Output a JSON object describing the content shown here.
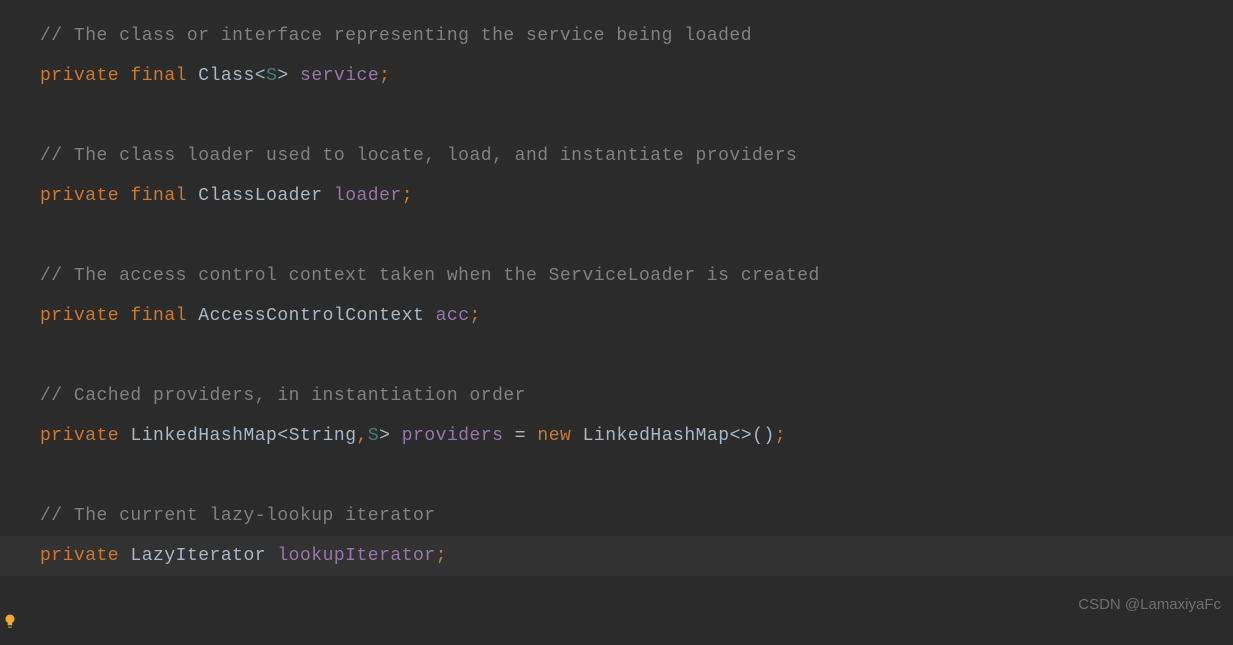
{
  "code": {
    "lines": [
      {
        "tokens": [
          {
            "t": "// The class or interface representing the service being loaded",
            "c": "tok-comment"
          }
        ]
      },
      {
        "tokens": [
          {
            "t": "private",
            "c": "tok-keyword"
          },
          {
            "t": " ",
            "c": ""
          },
          {
            "t": "final",
            "c": "tok-keyword"
          },
          {
            "t": " ",
            "c": ""
          },
          {
            "t": "Class",
            "c": "tok-type"
          },
          {
            "t": "<",
            "c": "tok-punct"
          },
          {
            "t": "S",
            "c": "tok-generic"
          },
          {
            "t": ">",
            "c": "tok-punct"
          },
          {
            "t": " ",
            "c": ""
          },
          {
            "t": "service",
            "c": "tok-field"
          },
          {
            "t": ";",
            "c": "tok-semi"
          }
        ]
      },
      {
        "tokens": [
          {
            "t": "",
            "c": ""
          }
        ]
      },
      {
        "tokens": [
          {
            "t": "// The class loader used to locate, load, and instantiate providers",
            "c": "tok-comment"
          }
        ]
      },
      {
        "tokens": [
          {
            "t": "private",
            "c": "tok-keyword"
          },
          {
            "t": " ",
            "c": ""
          },
          {
            "t": "final",
            "c": "tok-keyword"
          },
          {
            "t": " ",
            "c": ""
          },
          {
            "t": "ClassLoader",
            "c": "tok-type"
          },
          {
            "t": " ",
            "c": ""
          },
          {
            "t": "loader",
            "c": "tok-field"
          },
          {
            "t": ";",
            "c": "tok-semi"
          }
        ]
      },
      {
        "tokens": [
          {
            "t": "",
            "c": ""
          }
        ]
      },
      {
        "tokens": [
          {
            "t": "// The access control context taken when the ServiceLoader is created",
            "c": "tok-comment"
          }
        ]
      },
      {
        "tokens": [
          {
            "t": "private",
            "c": "tok-keyword"
          },
          {
            "t": " ",
            "c": ""
          },
          {
            "t": "final",
            "c": "tok-keyword"
          },
          {
            "t": " ",
            "c": ""
          },
          {
            "t": "AccessControlContext",
            "c": "tok-type"
          },
          {
            "t": " ",
            "c": ""
          },
          {
            "t": "acc",
            "c": "tok-field"
          },
          {
            "t": ";",
            "c": "tok-semi"
          }
        ]
      },
      {
        "tokens": [
          {
            "t": "",
            "c": ""
          }
        ]
      },
      {
        "tokens": [
          {
            "t": "// Cached providers, in instantiation order",
            "c": "tok-comment"
          }
        ]
      },
      {
        "tokens": [
          {
            "t": "private",
            "c": "tok-keyword"
          },
          {
            "t": " ",
            "c": ""
          },
          {
            "t": "LinkedHashMap",
            "c": "tok-type"
          },
          {
            "t": "<",
            "c": "tok-punct"
          },
          {
            "t": "String",
            "c": "tok-type"
          },
          {
            "t": ",",
            "c": "tok-semi"
          },
          {
            "t": "S",
            "c": "tok-generic"
          },
          {
            "t": ">",
            "c": "tok-punct"
          },
          {
            "t": " ",
            "c": ""
          },
          {
            "t": "providers",
            "c": "tok-field"
          },
          {
            "t": " ",
            "c": ""
          },
          {
            "t": "=",
            "c": "tok-op"
          },
          {
            "t": " ",
            "c": ""
          },
          {
            "t": "new",
            "c": "tok-keyword"
          },
          {
            "t": " ",
            "c": ""
          },
          {
            "t": "LinkedHashMap",
            "c": "tok-type"
          },
          {
            "t": "<>()",
            "c": "tok-punct"
          },
          {
            "t": ";",
            "c": "tok-semi"
          }
        ]
      },
      {
        "tokens": [
          {
            "t": "",
            "c": ""
          }
        ]
      },
      {
        "tokens": [
          {
            "t": "// The current lazy-lookup iterator",
            "c": "tok-comment"
          }
        ]
      },
      {
        "highlight": true,
        "tokens": [
          {
            "t": "private",
            "c": "tok-keyword"
          },
          {
            "t": " ",
            "c": ""
          },
          {
            "t": "LazyIterator",
            "c": "tok-type"
          },
          {
            "t": " ",
            "c": ""
          },
          {
            "t": "lookupIterator",
            "c": "tok-field"
          },
          {
            "t": ";",
            "c": "tok-semi"
          }
        ]
      }
    ]
  },
  "watermark": "CSDN @LamaxiyaFc",
  "icons": {
    "bulb": "intention-bulb-icon"
  }
}
